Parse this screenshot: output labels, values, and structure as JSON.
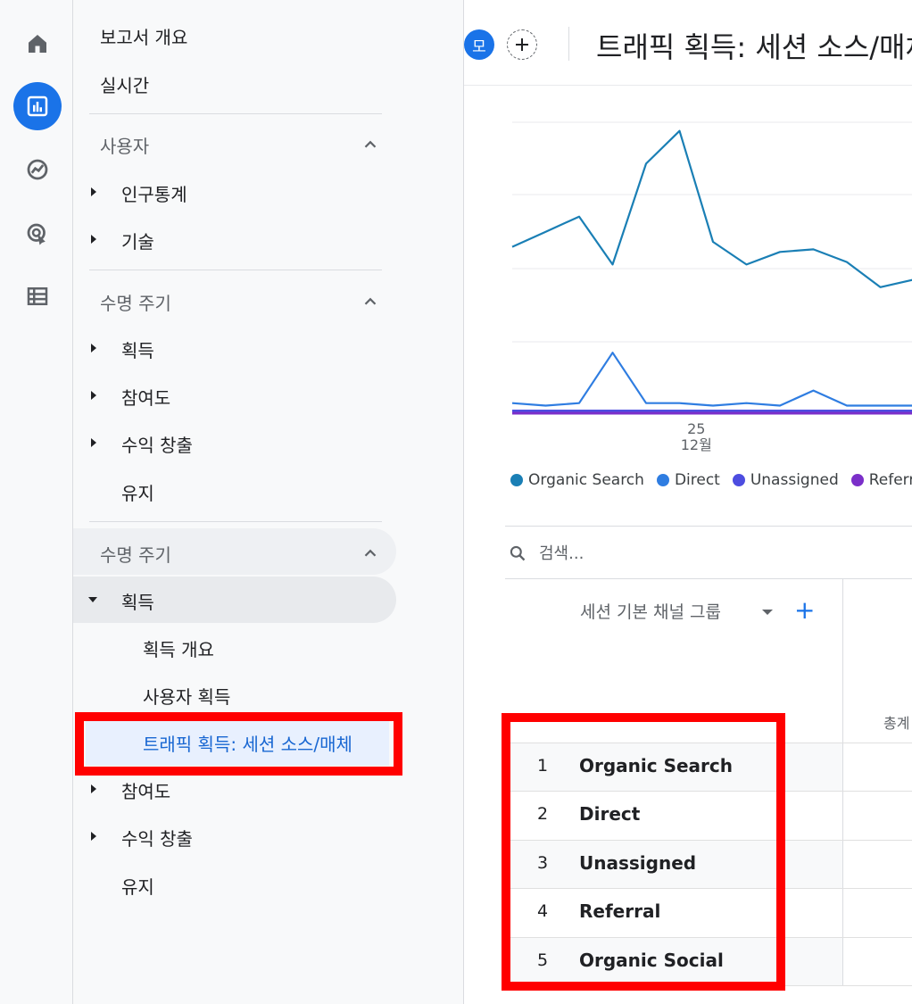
{
  "topbar": {
    "avatar_letter": "모",
    "page_title": "트래픽 획득: 세션 소스/매체"
  },
  "nav": {
    "report_overview": "보고서 개요",
    "realtime": "실시간",
    "section_user": "사용자",
    "demographics": "인구통계",
    "tech": "기술",
    "section_lifecycle_1": "수명 주기",
    "acquisition_1": "획득",
    "engagement_1": "참여도",
    "monetization_1": "수익 창출",
    "retention_1": "유지",
    "section_lifecycle_2": "수명 주기",
    "acquisition_2": "획득",
    "acq_overview": "획득 개요",
    "user_acquisition": "사용자 획득",
    "traffic_acquisition": "트래픽 획득: 세션 소스/매체",
    "engagement_2": "참여도",
    "monetization_2": "수익 창출",
    "retention_2": "유지"
  },
  "chart_data": {
    "type": "line",
    "x_tick_labels": [
      {
        "day": "25",
        "month": "12월"
      }
    ],
    "legend": [
      "Organic Search",
      "Direct",
      "Unassigned",
      "Referral"
    ],
    "colors": {
      "Organic Search": "#1a7fb5",
      "Direct": "#2f7de1",
      "Unassigned": "#4d4de0",
      "Referral": "#7b2fc9"
    },
    "series": [
      {
        "name": "Organic Search",
        "values": [
          66,
          72,
          78,
          59,
          99,
          112,
          68,
          59,
          64,
          65,
          60,
          50,
          53
        ]
      },
      {
        "name": "Direct",
        "values": [
          4,
          3,
          4,
          24,
          4,
          4,
          3,
          4,
          3,
          9,
          3,
          3,
          3
        ]
      },
      {
        "name": "Unassigned",
        "values": [
          1,
          1,
          1,
          1,
          1,
          1,
          1,
          1,
          1,
          1,
          1,
          1,
          1
        ]
      },
      {
        "name": "Referral",
        "values": [
          0,
          0,
          0,
          0,
          0,
          0,
          0,
          0,
          0,
          0,
          0,
          0,
          0
        ]
      }
    ],
    "ylim": [
      0,
      125
    ]
  },
  "search": {
    "placeholder": "검색..."
  },
  "table": {
    "dimension_header": "세션 기본 채널 그룹",
    "add_symbol": "+",
    "total_label": "총계",
    "rows": [
      {
        "index": "1",
        "name": "Organic Search"
      },
      {
        "index": "2",
        "name": "Direct"
      },
      {
        "index": "3",
        "name": "Unassigned"
      },
      {
        "index": "4",
        "name": "Referral"
      },
      {
        "index": "5",
        "name": "Organic Social"
      }
    ]
  },
  "colors": {
    "accent": "#1a73e8",
    "highlight_box": "#ff0000"
  }
}
